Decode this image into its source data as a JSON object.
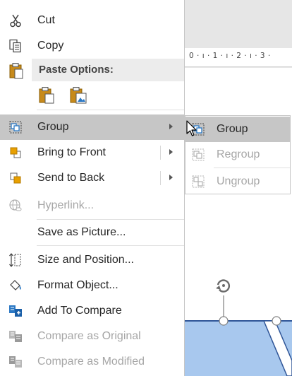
{
  "ruler": {
    "text": "0 · ı · 1 · ı · 2 · ı · 3 ·"
  },
  "menu": {
    "cut": {
      "label": "Cut",
      "icon": "scissors-icon"
    },
    "copy": {
      "label": "Copy",
      "icon": "copy-icon"
    },
    "paste_options": {
      "label": "Paste Options:",
      "icon": "clipboard-icon"
    },
    "group": {
      "label": "Group",
      "icon": "group-icon"
    },
    "bring_to_front": {
      "label": "Bring to Front",
      "icon": "bring-to-front-icon"
    },
    "send_to_back": {
      "label": "Send to Back",
      "icon": "send-to-back-icon"
    },
    "hyperlink": {
      "label": "Hyperlink...",
      "icon": "globe-link-icon"
    },
    "save_as_picture": {
      "label": "Save as Picture..."
    },
    "size_and_position": {
      "label": "Size and Position...",
      "icon": "size-position-icon"
    },
    "format_object": {
      "label": "Format Object...",
      "icon": "format-paint-icon"
    },
    "add_to_compare": {
      "label": "Add To Compare",
      "icon": "compare-icon"
    },
    "compare_as_original": {
      "label": "Compare as Original",
      "icon": "compare-original-icon"
    },
    "compare_as_modified": {
      "label": "Compare as Modified",
      "icon": "compare-modified-icon"
    }
  },
  "submenu": {
    "group": {
      "label": "Group"
    },
    "regroup": {
      "label": "Regroup"
    },
    "ungroup": {
      "label": "Ungroup"
    }
  },
  "colors": {
    "highlight": "#c6c6c6",
    "disabled_text": "#a6a6a6",
    "shape_fill": "#a8c8ee",
    "shape_border": "#2f5597",
    "icon_blue": "#2b78c4",
    "icon_orange": "#e8a000"
  }
}
